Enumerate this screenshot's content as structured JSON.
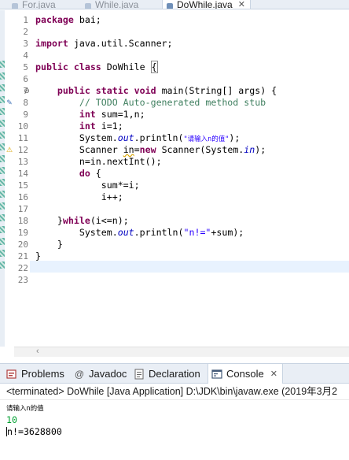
{
  "editor_tabs": [
    {
      "label": "For.java",
      "active": false,
      "icon": "java-file-icon"
    },
    {
      "label": "While.java",
      "active": false,
      "icon": "java-file-icon"
    },
    {
      "label": "DoWhile.java",
      "active": true,
      "icon": "java-file-icon",
      "close": "✕"
    }
  ],
  "line_numbers": [
    "1",
    "2",
    "3",
    "4",
    "5",
    "6",
    "7",
    "8",
    "9",
    "10",
    "11",
    "12",
    "13",
    "14",
    "15",
    "16",
    "17",
    "18",
    "19",
    "20",
    "21",
    "22",
    "23"
  ],
  "code": {
    "l1a": "package",
    "l1b": " bai;",
    "l3a": "import",
    "l3b": " java.util.Scanner;",
    "l5a": "public",
    "l5b": "class",
    "l5c": " DoWhile ",
    "l5d": "{",
    "l7a": "public",
    "l7b": "static",
    "l7c": "void",
    "l7d": " main(String[] args) {",
    "l8": "// TODO Auto-generated method stub",
    "l9a": "int",
    "l9b": " sum=1,n;",
    "l10a": "int",
    "l10b": " i=1;",
    "l11a": "System.",
    "l11b": "out",
    "l11c": ".println(",
    "l11d": "\"请输入n的值\"",
    "l11e": ");",
    "l12a": "Scanner ",
    "l12b": "in",
    "l12c": "=",
    "l12d": "new",
    "l12e": " Scanner(System.",
    "l12f": "in",
    "l12g": ");",
    "l13": "n=in.nextInt();",
    "l14a": "do",
    "l14b": " {",
    "l15": "sum*=i;",
    "l16": "i++;",
    "l18a": "}",
    "l18b": "while",
    "l18c": "(i<=n);",
    "l19a": "System.",
    "l19b": "out",
    "l19c": ".println(",
    "l19d": "\"n!=\"",
    "l19e": "+sum);",
    "l20": "}",
    "l21": "}"
  },
  "views": {
    "tabs": [
      {
        "label": "Problems",
        "icon": "problems-icon"
      },
      {
        "label": "Javadoc",
        "icon": "at-icon",
        "glyph": "@"
      },
      {
        "label": "Declaration",
        "icon": "declaration-icon"
      },
      {
        "label": "Console",
        "icon": "console-icon",
        "active": true,
        "close": "✕"
      }
    ]
  },
  "console": {
    "header": "<terminated> DoWhile [Java Application] D:\\JDK\\bin\\javaw.exe (2019年3月2",
    "lines": [
      "请输入n的值",
      "10",
      "n!=3628800"
    ]
  },
  "colors": {
    "keyword": "#7f0055",
    "comment": "#3f7f5f",
    "string": "#2a00ff",
    "field": "#0000c0",
    "console_input": "#00a030"
  }
}
